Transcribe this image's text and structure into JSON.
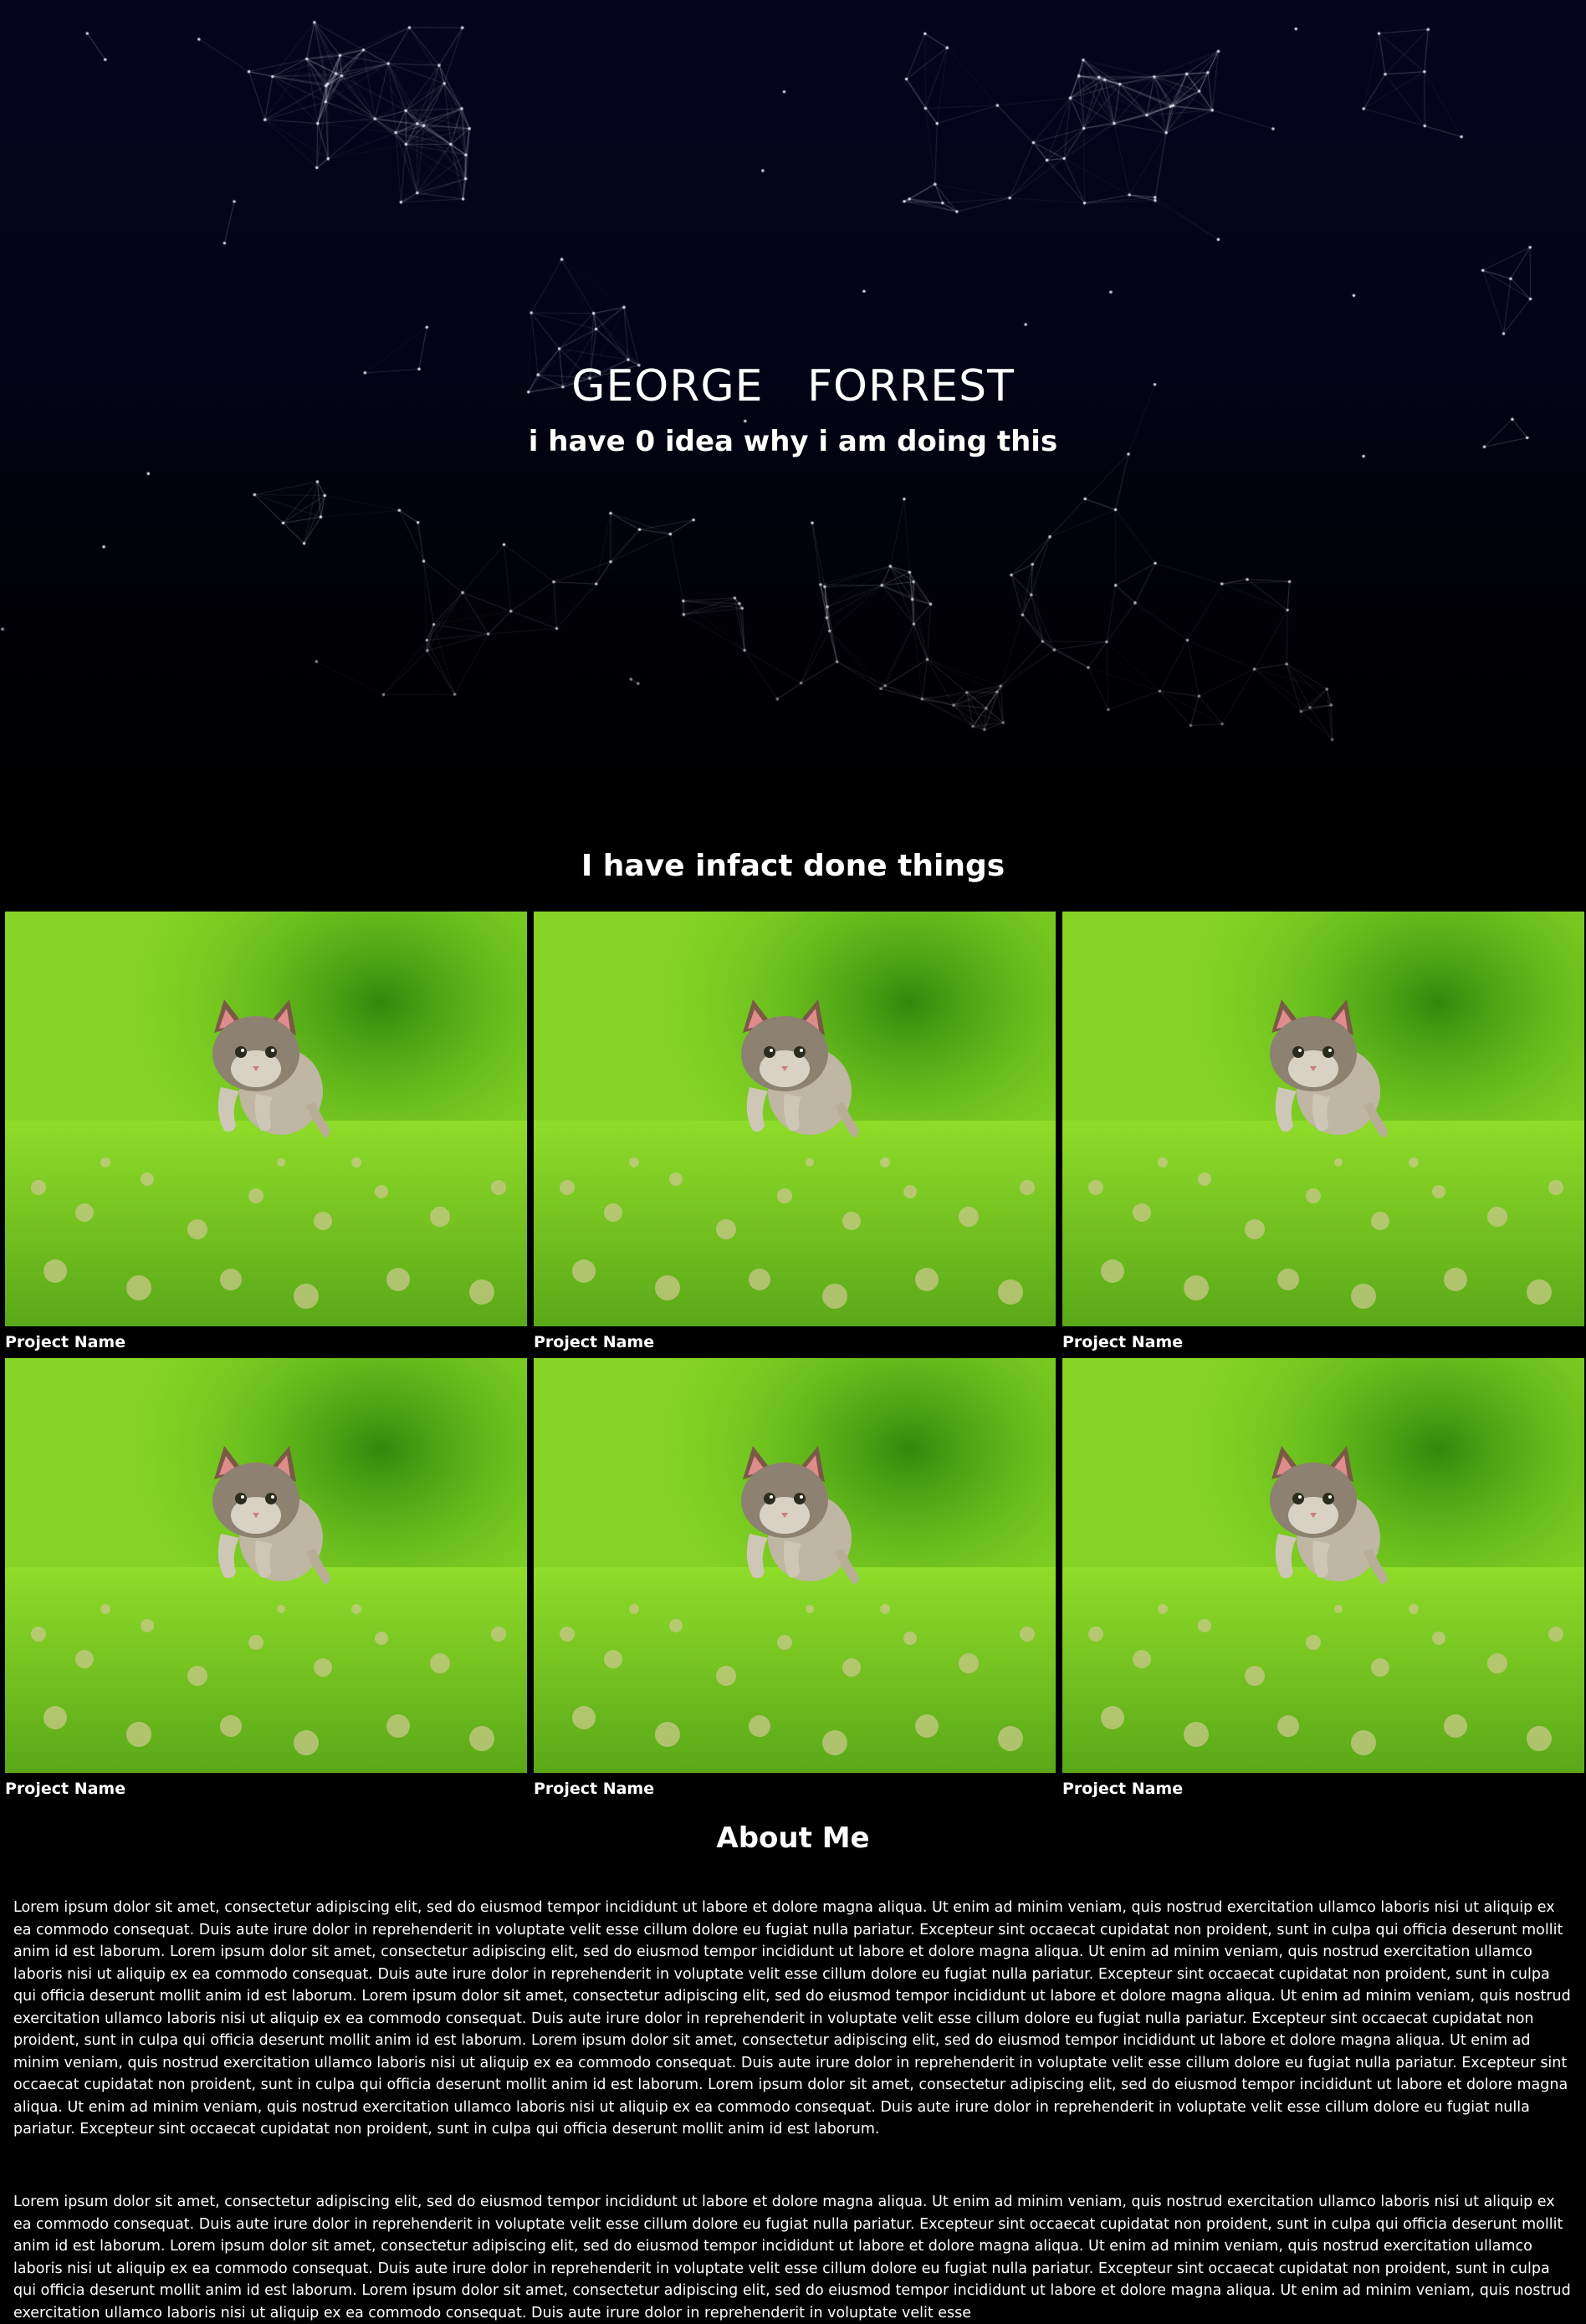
{
  "hero": {
    "name": "GEORGE   FORREST",
    "tagline": "i have 0 idea why i am doing this"
  },
  "projects": {
    "heading": "I have infact done things",
    "items": [
      {
        "label": "Project Name"
      },
      {
        "label": "Project Name"
      },
      {
        "label": "Project Name"
      },
      {
        "label": "Project Name"
      },
      {
        "label": "Project Name"
      },
      {
        "label": "Project Name"
      }
    ]
  },
  "about": {
    "heading": "About Me",
    "paragraphs": [
      "Lorem ipsum dolor sit amet, consectetur adipiscing elit, sed do eiusmod tempor incididunt ut labore et dolore magna aliqua. Ut enim ad minim veniam, quis nostrud exercitation ullamco laboris nisi ut aliquip ex ea commodo consequat. Duis aute irure dolor in reprehenderit in voluptate velit esse cillum dolore eu fugiat nulla pariatur. Excepteur sint occaecat cupidatat non proident, sunt in culpa qui officia deserunt mollit anim id est laborum. Lorem ipsum dolor sit amet, consectetur adipiscing elit, sed do eiusmod tempor incididunt ut labore et dolore magna aliqua. Ut enim ad minim veniam, quis nostrud exercitation ullamco laboris nisi ut aliquip ex ea commodo consequat. Duis aute irure dolor in reprehenderit in voluptate velit esse cillum dolore eu fugiat nulla pariatur. Excepteur sint occaecat cupidatat non proident, sunt in culpa qui officia deserunt mollit anim id est laborum. Lorem ipsum dolor sit amet, consectetur adipiscing elit, sed do eiusmod tempor incididunt ut labore et dolore magna aliqua. Ut enim ad minim veniam, quis nostrud exercitation ullamco laboris nisi ut aliquip ex ea commodo consequat. Duis aute irure dolor in reprehenderit in voluptate velit esse cillum dolore eu fugiat nulla pariatur. Excepteur sint occaecat cupidatat non proident, sunt in culpa qui officia deserunt mollit anim id est laborum. Lorem ipsum dolor sit amet, consectetur adipiscing elit, sed do eiusmod tempor incididunt ut labore et dolore magna aliqua. Ut enim ad minim veniam, quis nostrud exercitation ullamco laboris nisi ut aliquip ex ea commodo consequat. Duis aute irure dolor in reprehenderit in voluptate velit esse cillum dolore eu fugiat nulla pariatur. Excepteur sint occaecat cupidatat non proident, sunt in culpa qui officia deserunt mollit anim id est laborum. Lorem ipsum dolor sit amet, consectetur adipiscing elit, sed do eiusmod tempor incididunt ut labore et dolore magna aliqua. Ut enim ad minim veniam, quis nostrud exercitation ullamco laboris nisi ut aliquip ex ea commodo consequat. Duis aute irure dolor in reprehenderit in voluptate velit esse cillum dolore eu fugiat nulla pariatur. Excepteur sint occaecat cupidatat non proident, sunt in culpa qui officia deserunt mollit anim id est laborum.",
      "Lorem ipsum dolor sit amet, consectetur adipiscing elit, sed do eiusmod tempor incididunt ut labore et dolore magna aliqua. Ut enim ad minim veniam, quis nostrud exercitation ullamco laboris nisi ut aliquip ex ea commodo consequat. Duis aute irure dolor in reprehenderit in voluptate velit esse cillum dolore eu fugiat nulla pariatur. Excepteur sint occaecat cupidatat non proident, sunt in culpa qui officia deserunt mollit anim id est laborum. Lorem ipsum dolor sit amet, consectetur adipiscing elit, sed do eiusmod tempor incididunt ut labore et dolore magna aliqua. Ut enim ad minim veniam, quis nostrud exercitation ullamco laboris nisi ut aliquip ex ea commodo consequat. Duis aute irure dolor in reprehenderit in voluptate velit esse cillum dolore eu fugiat nulla pariatur. Excepteur sint occaecat cupidatat non proident, sunt in culpa qui officia deserunt mollit anim id est laborum. Lorem ipsum dolor sit amet, consectetur adipiscing elit, sed do eiusmod tempor incididunt ut labore et dolore magna aliqua. Ut enim ad minim veniam, quis nostrud exercitation ullamco laboris nisi ut aliquip ex ea commodo consequat. Duis aute irure dolor in reprehenderit in voluptate velit esse"
    ]
  }
}
